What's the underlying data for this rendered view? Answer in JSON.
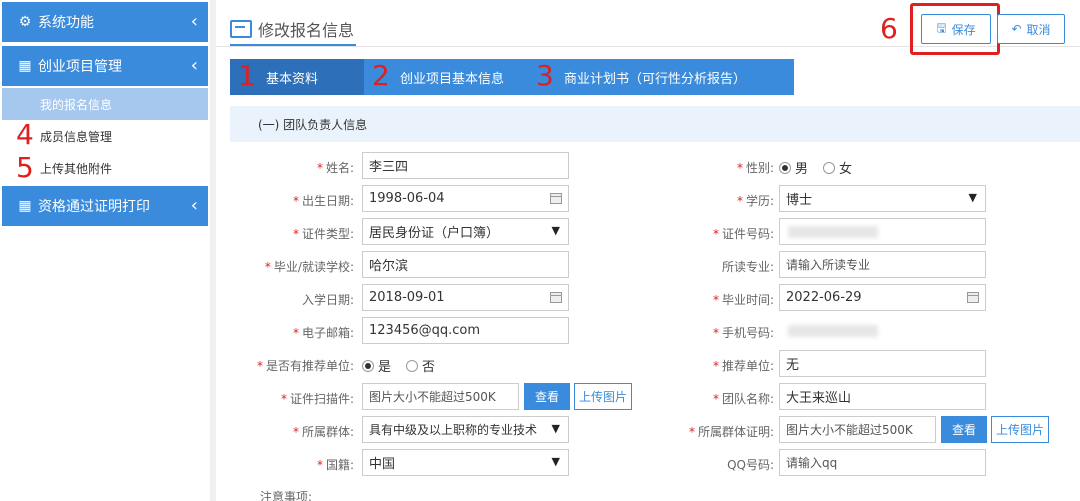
{
  "sidebar": {
    "menu1": {
      "icon": "gear-icon",
      "label": "系统功能"
    },
    "menu2": {
      "icon": "grid-icon",
      "label": "创业项目管理"
    },
    "submenu": [
      {
        "label": "我的报名信息",
        "active": true
      },
      {
        "label": "成员信息管理",
        "marker": "4"
      },
      {
        "label": "上传其他附件",
        "marker": "5"
      }
    ],
    "menu3": {
      "icon": "grid-icon",
      "label": "资格通过证明打印"
    },
    "chevron": "‹"
  },
  "header": {
    "title": "修改报名信息",
    "save_label": "保存",
    "cancel_label": "取消",
    "save_marker": "6"
  },
  "tabs": [
    {
      "marker": "1",
      "label": "基本资料",
      "active": true
    },
    {
      "marker": "2",
      "label": "创业项目基本信息",
      "active": false
    },
    {
      "marker": "3",
      "label": "商业计划书（可行性分析报告）",
      "active": false
    }
  ],
  "section": {
    "title": "(一) 团队负责人信息"
  },
  "form": {
    "name": {
      "label": "姓名:",
      "value": "李三四",
      "required": true
    },
    "gender": {
      "label": "性别:",
      "options": [
        "男",
        "女"
      ],
      "selected": "男",
      "required": true
    },
    "birth": {
      "label": "出生日期:",
      "value": "1998-06-04",
      "required": true
    },
    "education": {
      "label": "学历:",
      "value": "博士",
      "required": true
    },
    "id_type": {
      "label": "证件类型:",
      "value": "居民身份证（户口簿）",
      "required": true
    },
    "id_no": {
      "label": "证件号码:",
      "value": "",
      "required": true
    },
    "school": {
      "label": "毕业/就读学校:",
      "value": "哈尔滨",
      "required": true
    },
    "major": {
      "label": "所读专业:",
      "placeholder": "请输入所读专业",
      "required": false
    },
    "enroll": {
      "label": "入学日期:",
      "value": "2018-09-01",
      "required": false
    },
    "graduate": {
      "label": "毕业时间:",
      "value": "2022-06-29",
      "required": true
    },
    "email": {
      "label": "电子邮箱:",
      "value": "123456@qq.com",
      "required": true
    },
    "phone": {
      "label": "手机号码:",
      "value": "",
      "required": true
    },
    "recommended": {
      "label": "是否有推荐单位:",
      "options": [
        "是",
        "否"
      ],
      "selected": "是",
      "required": true
    },
    "rec_unit": {
      "label": "推荐单位:",
      "value": "无",
      "required": true
    },
    "scan": {
      "label": "证件扫描件:",
      "placeholder": "图片大小不能超过500K",
      "required": true
    },
    "team": {
      "label": "团队名称:",
      "value": "大王来巡山",
      "required": true
    },
    "group": {
      "label": "所属群体:",
      "value": "具有中级及以上职称的专业技术",
      "required": true
    },
    "group_proof": {
      "label": "所属群体证明:",
      "placeholder": "图片大小不能超过500K",
      "required": true
    },
    "nation": {
      "label": "国籍:",
      "value": "中国",
      "required": true
    },
    "qq": {
      "label": "QQ号码:",
      "placeholder": "请输入qq",
      "required": false
    },
    "view_label": "查看",
    "upload_label": "上传图片"
  },
  "note": "注意事项:"
}
